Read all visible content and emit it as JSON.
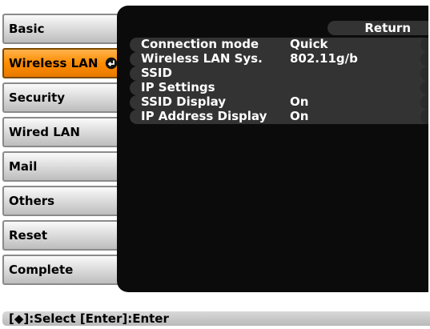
{
  "tabs": [
    {
      "label": "Basic",
      "active": false
    },
    {
      "label": "Wireless LAN",
      "active": true
    },
    {
      "label": "Security",
      "active": false
    },
    {
      "label": "Wired LAN",
      "active": false
    },
    {
      "label": "Mail",
      "active": false
    },
    {
      "label": "Others",
      "active": false
    },
    {
      "label": "Reset",
      "active": false
    },
    {
      "label": "Complete",
      "active": false
    }
  ],
  "panel": {
    "return_label": "Return",
    "settings": [
      {
        "label": "Connection mode",
        "value": "Quick"
      },
      {
        "label": "Wireless LAN Sys.",
        "value": "802.11g/b"
      },
      {
        "label": "SSID",
        "value": ""
      },
      {
        "label": "IP Settings",
        "value": ""
      },
      {
        "label": "SSID Display",
        "value": "On"
      },
      {
        "label": "IP Address Display",
        "value": "On"
      }
    ]
  },
  "statusbar": {
    "text": "[◆]:Select  [Enter]:Enter"
  },
  "colors": {
    "active_tab": "#ff8c00",
    "panel_bg": "#0b0b0b",
    "row_bg": "#333333"
  },
  "icons": {
    "enter": "enter-icon"
  }
}
